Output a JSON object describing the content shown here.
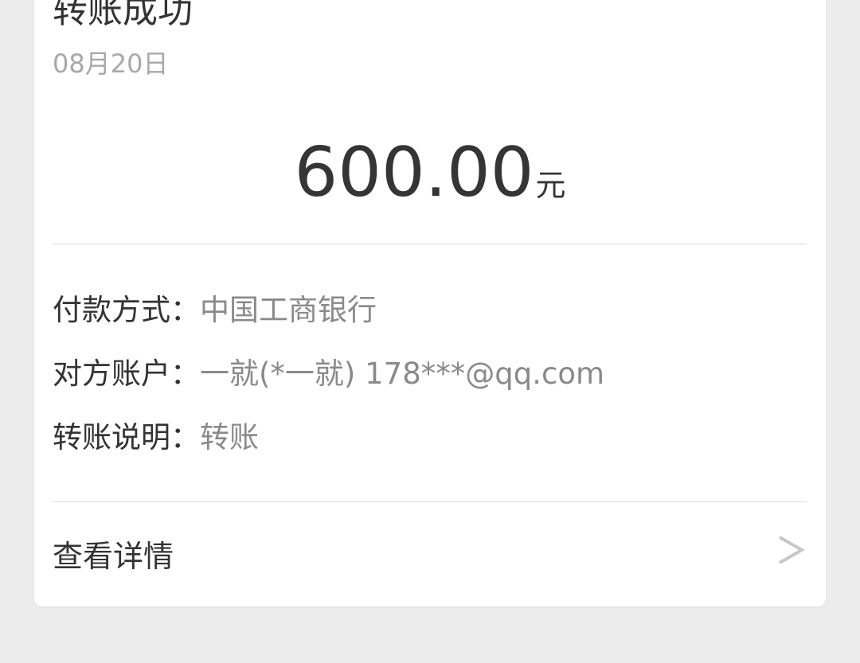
{
  "header": {
    "title": "转账成功",
    "date": "08月20日"
  },
  "amount": {
    "value": "600.00",
    "unit": "元"
  },
  "info": [
    {
      "label": "付款方式：",
      "value": "中国工商银行"
    },
    {
      "label": "对方账户：",
      "value": "一就(*一就) 178***@qq.com"
    },
    {
      "label": "转账说明：",
      "value": "转账"
    }
  ],
  "details_link": {
    "label": "查看详情",
    "icon": "chevron-right-icon"
  }
}
